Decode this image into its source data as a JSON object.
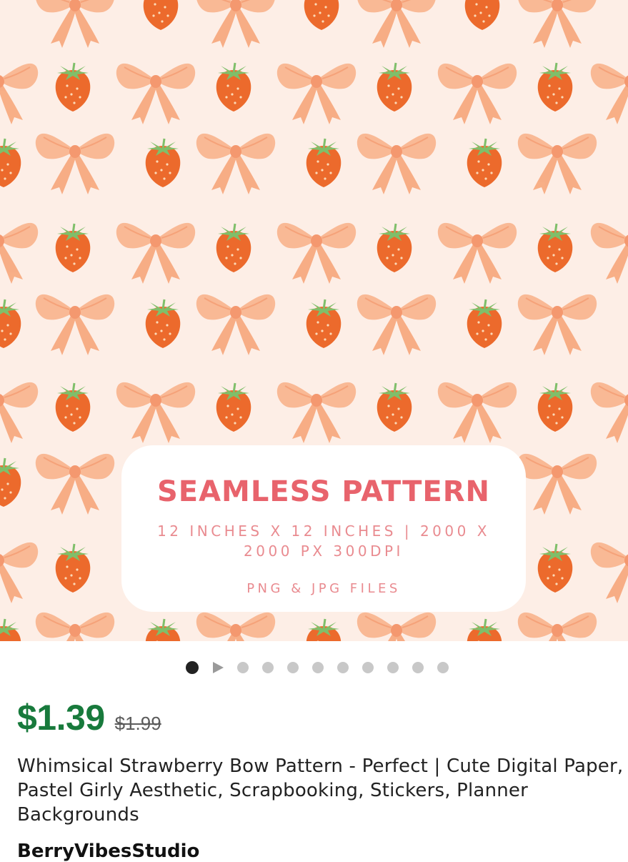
{
  "listing": {
    "image": {
      "pattern_motifs": [
        "strawberry",
        "bow"
      ],
      "colors": {
        "background": "#fdeee6",
        "strawberry": "#ec6a2c",
        "leaf": "#7fbf6a",
        "bow": "#f7a77b"
      },
      "promo": {
        "title": "SEAMLESS PATTERN",
        "subtitle_line1": "12 INCHES X 12 INCHES | 2000 X",
        "subtitle_line2": "2000 PX 300DPI",
        "files": "PNG & JPG FILES"
      }
    },
    "carousel": {
      "total": 11,
      "active_index": 0,
      "has_video": true
    },
    "price": "$1.39",
    "original_price": "$1.99",
    "title": "Whimsical Strawberry Bow Pattern - Perfect | Cute Digital Paper, Pastel Girly Aesthetic, Scrapbooking, Stickers, Planner Backgrounds",
    "shop_name": "BerryVibesStudio",
    "accent_price_color": "#187a3c"
  }
}
